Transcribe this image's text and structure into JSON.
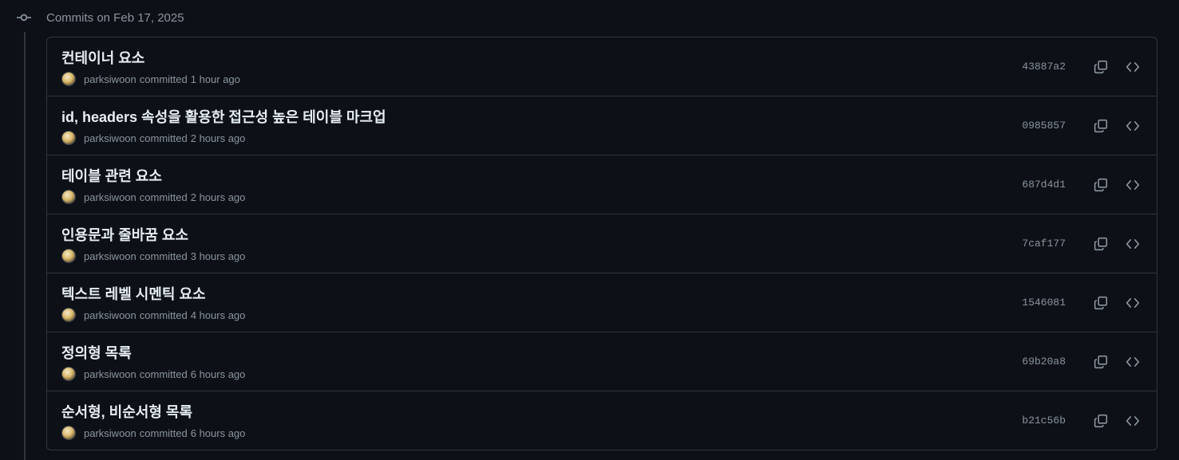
{
  "group": {
    "title": "Commits on Feb 17, 2025"
  },
  "commits": [
    {
      "title": "컨테이너 요소",
      "author": "parksiwoon",
      "action": "committed",
      "time": "1 hour ago",
      "sha": "43887a2"
    },
    {
      "title": "id, headers 속성을 활용한 접근성 높은 테이블 마크업",
      "author": "parksiwoon",
      "action": "committed",
      "time": "2 hours ago",
      "sha": "0985857"
    },
    {
      "title": "테이블 관련 요소",
      "author": "parksiwoon",
      "action": "committed",
      "time": "2 hours ago",
      "sha": "687d4d1"
    },
    {
      "title": "인용문과 줄바꿈 요소",
      "author": "parksiwoon",
      "action": "committed",
      "time": "3 hours ago",
      "sha": "7caf177"
    },
    {
      "title": "텍스트 레벨 시멘틱 요소",
      "author": "parksiwoon",
      "action": "committed",
      "time": "4 hours ago",
      "sha": "1546081"
    },
    {
      "title": "정의형 목록",
      "author": "parksiwoon",
      "action": "committed",
      "time": "6 hours ago",
      "sha": "69b20a8"
    },
    {
      "title": "순서형, 비순서형 목록",
      "author": "parksiwoon",
      "action": "committed",
      "time": "6 hours ago",
      "sha": "b21c56b"
    }
  ],
  "icons": {
    "commit": "git-commit-icon",
    "copy": "copy-icon",
    "browse": "code-icon"
  },
  "colors": {
    "background": "#0d1117",
    "border": "#30363d",
    "text_primary": "#e6edf3",
    "text_muted": "#8b949e"
  }
}
